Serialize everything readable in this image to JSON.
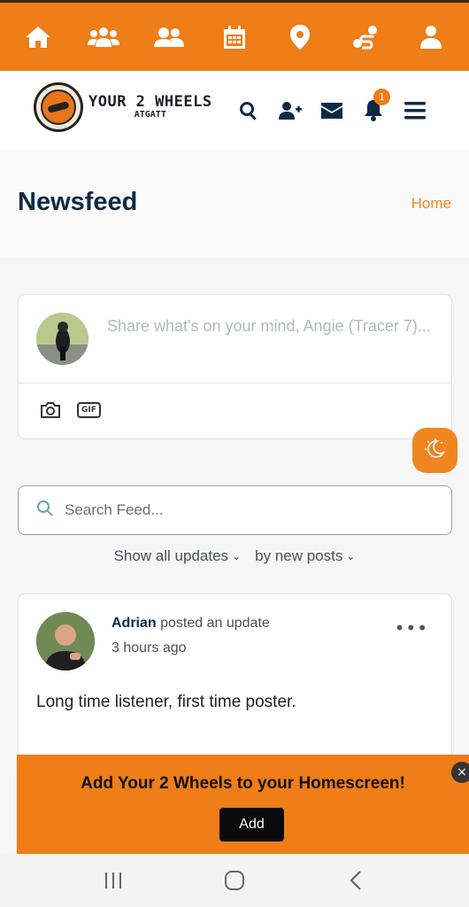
{
  "top_nav": {
    "icons": [
      "home-icon",
      "groups-icon",
      "members-icon",
      "calendar-icon",
      "map-pin-icon",
      "route-icon",
      "profile-icon"
    ]
  },
  "header": {
    "logo_title": "YOUR 2 WHEELS",
    "logo_subtitle": "ATGATT",
    "notification_count": "1"
  },
  "page": {
    "title": "Newsfeed",
    "breadcrumb": "Home"
  },
  "composer": {
    "placeholder": "Share what's on your mind, Angie (Tracer 7)...",
    "gif_label": "GIF"
  },
  "search": {
    "placeholder": "Search Feed..."
  },
  "filters": {
    "show": "Show all updates",
    "sort": "by new posts"
  },
  "post": {
    "author": "Adrian",
    "action": "posted an update",
    "time": "3 hours ago",
    "body": "Long time listener, first time poster.",
    "more": "•••"
  },
  "install_banner": {
    "text": "Add Your 2 Wheels to your Homescreen!",
    "button": "Add",
    "close": "×"
  },
  "colors": {
    "brand": "#ef7d18",
    "navy": "#0c2a45"
  }
}
